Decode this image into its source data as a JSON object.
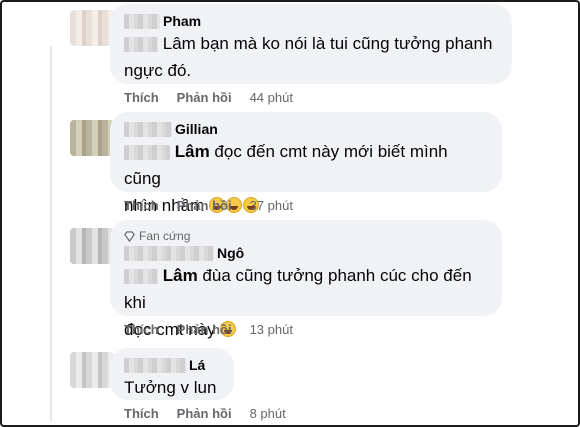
{
  "comments": [
    {
      "name": "Pham",
      "tag": "",
      "lines": [
        "Lâm bạn mà ko nói là tui cũng tưởng phanh",
        "ngực đó."
      ],
      "emoji_count": 0,
      "fan_badge": "",
      "actions": {
        "like": "Thích",
        "reply": "Phản hồi",
        "time": "44 phút"
      }
    },
    {
      "name": "Gillian",
      "tag": "Lâm",
      "lines": [
        " đọc đến cmt này mới biết mình cũng",
        "nhìn nhầm"
      ],
      "emoji_count": 3,
      "fan_badge": "",
      "actions": {
        "like": "Thích",
        "reply": "Phản hồi",
        "time": "37 phút"
      }
    },
    {
      "name": "Ngô",
      "tag": "Lâm",
      "lines": [
        " đùa cũng tưởng phanh cúc cho đến khi",
        "đọc cmt này"
      ],
      "emoji_count": 1,
      "fan_badge": "Fan cứng",
      "actions": {
        "like": "Thích",
        "reply": "Phản hồi",
        "time": "13 phút"
      }
    },
    {
      "name": "Lá",
      "tag": "",
      "lines": [
        "Tưởng v lun"
      ],
      "emoji_count": 0,
      "fan_badge": "",
      "actions": {
        "like": "Thích",
        "reply": "Phản hồi",
        "time": "8 phút"
      }
    }
  ],
  "icons": {
    "fan_badge": "diamond-icon",
    "emoji": "laughing-emoji-icon"
  },
  "colors": {
    "bubble": "#f0f2f5",
    "meta": "#65676b",
    "text": "#050505"
  }
}
